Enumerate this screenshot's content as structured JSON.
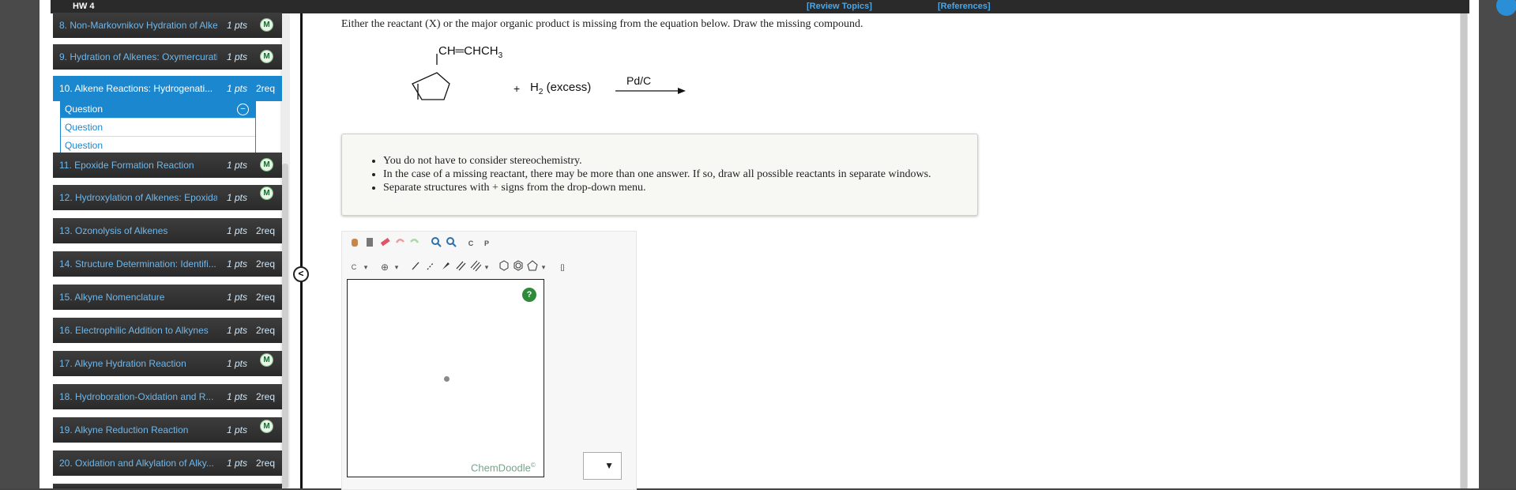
{
  "header": {
    "assignment": "HW 4",
    "review_link": "[Review Topics]",
    "references_link": "[References]"
  },
  "nav": {
    "items": [
      {
        "label": "8. Non-Markovnikov Hydration of Alke...",
        "pts": "1 pts",
        "badge": "M"
      },
      {
        "label": "9. Hydration of Alkenes: Oxymercurati...",
        "pts": "1 pts",
        "badge": "M"
      },
      {
        "label": "10. Alkene Reactions: Hydrogenati...",
        "pts": "1 pts",
        "req": "2req",
        "active": true
      },
      {
        "label": "11. Epoxide Formation Reaction",
        "pts": "1 pts",
        "badge": "M"
      },
      {
        "label": "12. Hydroxylation of Alkenes: Epoxida...",
        "pts": "1 pts",
        "badge": "M"
      },
      {
        "label": "13. Ozonolysis of Alkenes",
        "pts": "1 pts",
        "req": "2req"
      },
      {
        "label": "14. Structure Determination: Identifi...",
        "pts": "1 pts",
        "req": "2req"
      },
      {
        "label": "15. Alkyne Nomenclature",
        "pts": "1 pts",
        "req": "2req"
      },
      {
        "label": "16. Electrophilic Addition to Alkynes",
        "pts": "1 pts",
        "req": "2req"
      },
      {
        "label": "17. Alkyne Hydration Reaction",
        "pts": "1 pts",
        "badge": "M"
      },
      {
        "label": "18. Hydroboration-Oxidation and R...",
        "pts": "1 pts",
        "req": "2req"
      },
      {
        "label": "19. Alkyne Reduction Reaction",
        "pts": "1 pts",
        "badge": "M"
      },
      {
        "label": "20. Oxidation and Alkylation of Alky...",
        "pts": "1 pts",
        "req": "2req"
      }
    ],
    "sub_items": [
      "Question",
      "Question",
      "Question"
    ]
  },
  "question": {
    "prompt": "Either the reactant (X) or the major organic product is missing from the equation below. Draw the missing compound.",
    "substituent": "CH═CHCH",
    "substituent_sub": "3",
    "plus": "+",
    "reagent": "H",
    "reagent_sub": "2",
    "reagent_note": "(excess)",
    "catalyst": "Pd/C"
  },
  "instructions": [
    "You do not have to consider stereochemistry.",
    "In the case of a missing reactant, there may be more than one answer. If so, draw all possible reactants in separate windows.",
    "Separate structures with + signs from the drop-down menu."
  ],
  "editor": {
    "help": "?",
    "watermark": "ChemDoodle",
    "watermark_mark": "©",
    "atom_label": "C",
    "tool_c": "C",
    "tool_p": "P",
    "bracket": "[]"
  },
  "ui": {
    "collapse_symbol": "<",
    "minus_symbol": "−"
  },
  "colors": {
    "accent": "#1b87cf",
    "nav_bg": "#2e2e2e",
    "link": "#6fb7ea"
  }
}
